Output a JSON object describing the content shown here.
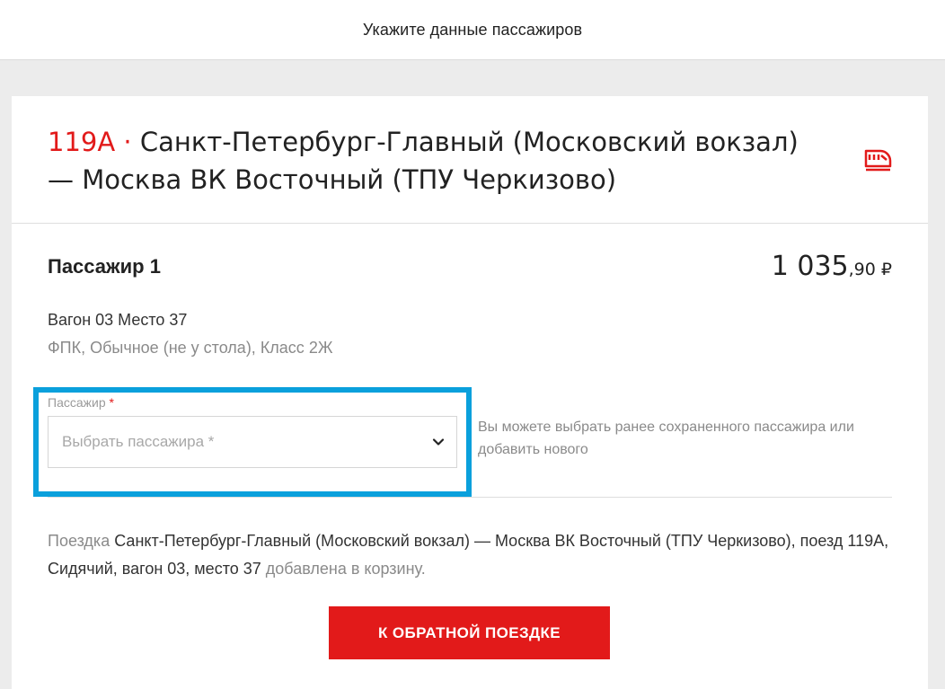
{
  "header": {
    "title": "Укажите данные пассажиров"
  },
  "route": {
    "train_number": "119А",
    "separator": " · ",
    "title": "Санкт-Петербург-Главный (Московский вокзал) — Москва ВК Восточный (ТПУ Черкизово)",
    "icon": "train-icon"
  },
  "passenger": {
    "label": "Пассажир 1",
    "price_main": "1 035",
    "price_cents": ",90 ₽",
    "wagon_seat": "Вагон 03 Место 37",
    "class_info": "ФПК, Обычное (не у стола), Класс 2Ж",
    "field_label": "Пассажир",
    "required_mark": "*",
    "select_placeholder": "Выбрать пассажира *",
    "hint": "Вы можете выбрать ранее сохраненного пассажира или добавить нового"
  },
  "trip_info": {
    "prefix": "Поездка",
    "details": "Санкт-Петербург-Главный (Московский вокзал) — Москва ВК Восточный (ТПУ Черкизово), поезд 119А, Сидячий, вагон 03, место 37",
    "suffix": "добавлена в корзину."
  },
  "buttons": {
    "return_trip": "К ОБРАТНОЙ ПОЕЗДКЕ"
  },
  "colors": {
    "accent": "#e21a1a",
    "highlight": "#0aa0dc"
  }
}
